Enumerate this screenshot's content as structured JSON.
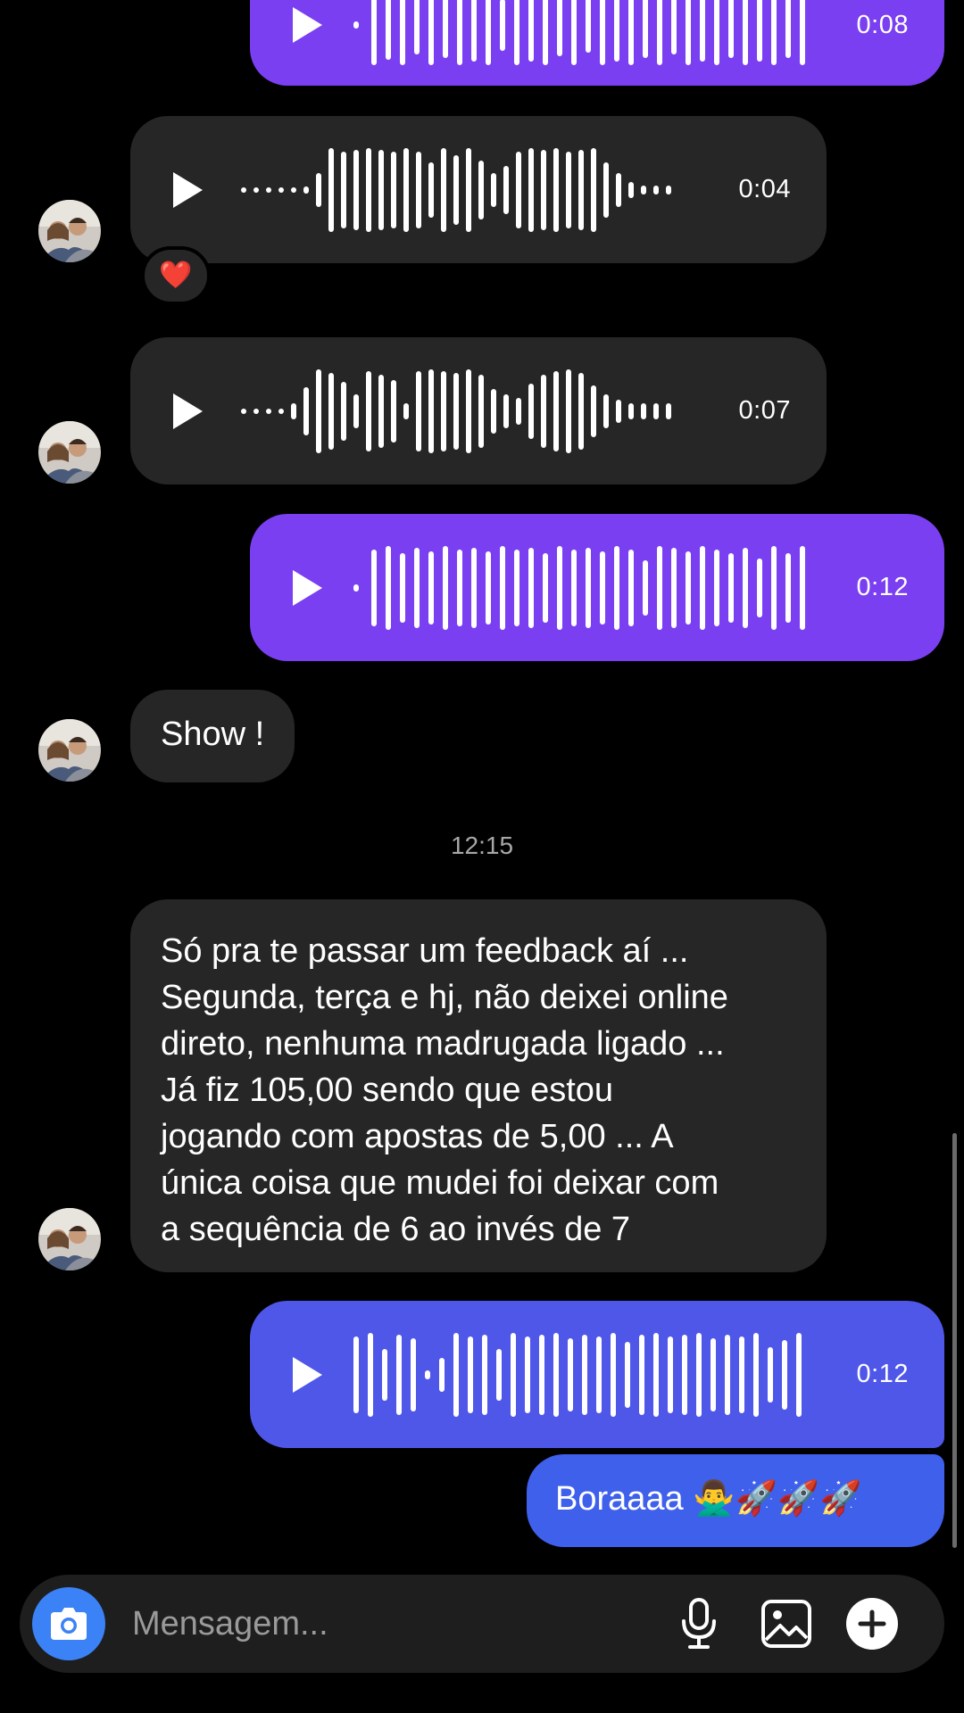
{
  "messages": {
    "voice1": {
      "duration": "0:08"
    },
    "voice2": {
      "duration": "0:04",
      "reaction": "❤️"
    },
    "voice3": {
      "duration": "0:07"
    },
    "voice4": {
      "duration": "0:12"
    },
    "text1": {
      "text": "Show !"
    },
    "timestamp": "12:15",
    "text2": {
      "lines": [
        "Só pra te passar um feedback aí ...",
        "Segunda, terça e hj, não deixei online",
        "direto, nenhuma madrugada ligado ...",
        "Já fiz 105,00 sendo que estou",
        "jogando com apostas de 5,00 ... A",
        "única coisa que mudei foi deixar com",
        "a sequência de 6 ao invés de 7"
      ]
    },
    "voice5": {
      "duration": "0:12"
    },
    "text3": {
      "text": "Boraaaa 🙅‍♂️🚀🚀🚀"
    }
  },
  "composer": {
    "placeholder": "Mensagem..."
  },
  "colors": {
    "incoming": "#262626",
    "outgoing_purple": "#7b3ff2",
    "outgoing_indigo": "#4f57e8",
    "outgoing_blue": "#3f60eb",
    "camera_button": "#3b82f6"
  },
  "icons": {
    "play": "play-icon",
    "heart": "heart-reaction",
    "camera": "camera-icon",
    "microphone": "microphone-icon",
    "gallery": "gallery-icon",
    "add": "plus-circle-icon"
  }
}
